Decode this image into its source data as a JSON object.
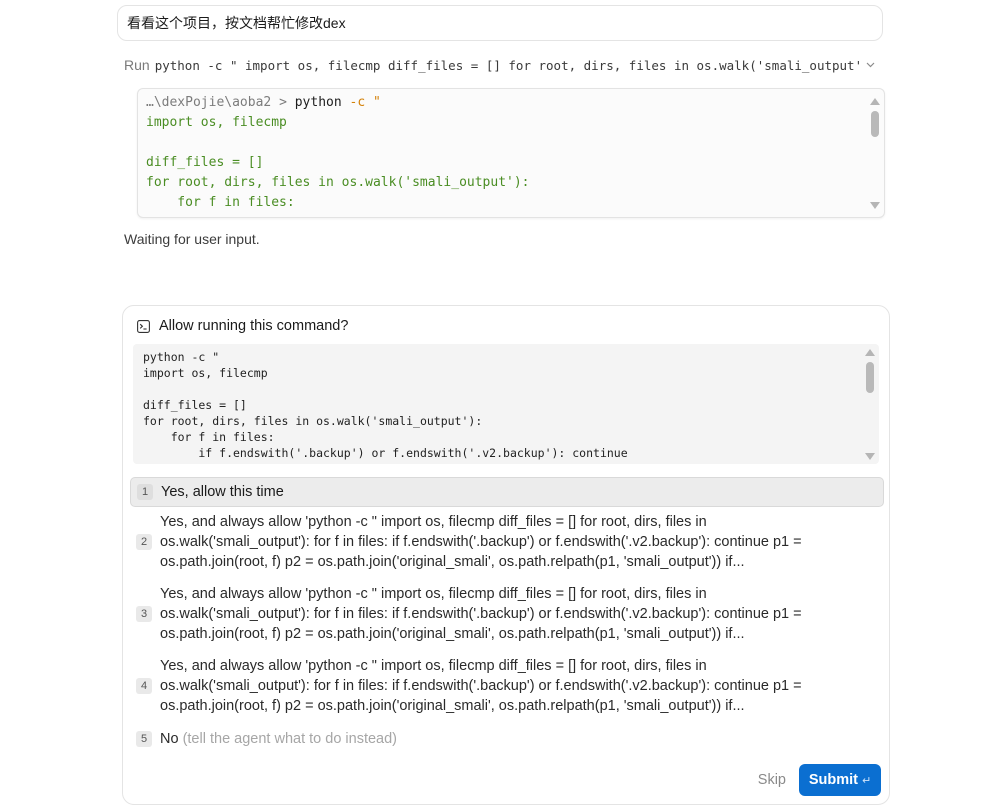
{
  "user_message": "看看这个项目，按文档帮忙修改dex",
  "run": {
    "label": "Run",
    "command": "python -c \" import os, filecmp diff_files = [] for root, dirs, files in os.walk('smali_output'): for f in files:"
  },
  "terminal": {
    "path": "…\\dexPojie\\aoba2",
    "prompt": ">",
    "cmd": "python",
    "flag": "-c",
    "quote": "\"",
    "code_lines": [
      "import os, filecmp",
      "",
      "diff_files = []",
      "for root, dirs, files in os.walk('smali_output'):",
      "    for f in files:"
    ]
  },
  "status": "Waiting for user input.",
  "approval": {
    "title": "Allow running this command?",
    "command_lines": [
      "python -c \"",
      "import os, filecmp",
      "",
      "diff_files = []",
      "for root, dirs, files in os.walk('smali_output'):",
      "    for f in files:",
      "        if f.endswith('.backup') or f.endswith('.v2.backup'): continue"
    ],
    "options": [
      {
        "num": "1",
        "lines": [
          "Yes, allow this time"
        ]
      },
      {
        "num": "2",
        "lines": [
          "Yes, and always allow 'python -c \" import os, filecmp diff_files = [] for root, dirs, files in",
          "os.walk('smali_output'): for f in files: if f.endswith('.backup') or f.endswith('.v2.backup'): continue p1 =",
          "os.path.join(root, f) p2 = os.path.join('original_smali', os.path.relpath(p1, 'smali_output')) if..."
        ]
      },
      {
        "num": "3",
        "lines": [
          "Yes, and always allow 'python -c \" import os, filecmp diff_files = [] for root, dirs, files in",
          "os.walk('smali_output'): for f in files: if f.endswith('.backup') or f.endswith('.v2.backup'): continue p1 =",
          "os.path.join(root, f) p2 = os.path.join('original_smali', os.path.relpath(p1, 'smali_output')) if..."
        ]
      },
      {
        "num": "4",
        "lines": [
          "Yes, and always allow 'python -c \" import os, filecmp diff_files = [] for root, dirs, files in",
          "os.walk('smali_output'): for f in files: if f.endswith('.backup') or f.endswith('.v2.backup'): continue p1 =",
          "os.path.join(root, f) p2 = os.path.join('original_smali', os.path.relpath(p1, 'smali_output')) if..."
        ]
      },
      {
        "num": "5",
        "label": "No",
        "hint": "(tell the agent what to do instead)"
      }
    ],
    "skip_label": "Skip",
    "submit_label": "Submit",
    "submit_icon": "↵"
  },
  "colors": {
    "accent": "#0b6fd1",
    "code_green": "#4a8d23",
    "flag_orange": "#d4820a"
  }
}
